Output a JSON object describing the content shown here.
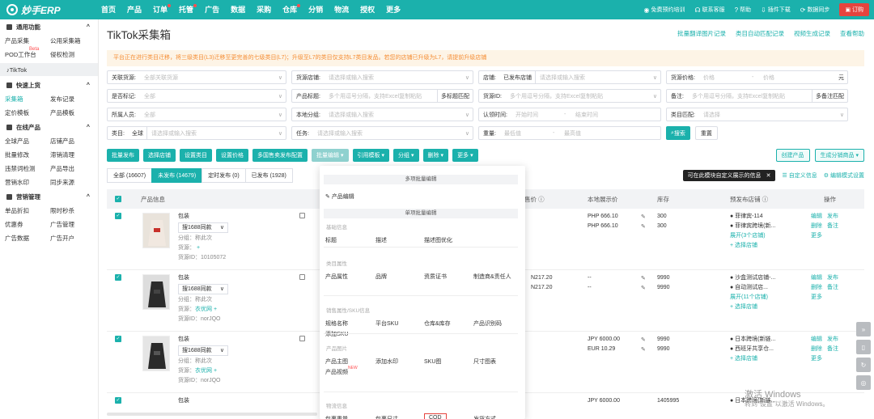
{
  "topnav": {
    "logo": "妙手ERP",
    "items": [
      {
        "label": "首页",
        "dot": false
      },
      {
        "label": "产品",
        "dot": false
      },
      {
        "label": "订单",
        "dot": true
      },
      {
        "label": "托管",
        "dot": true
      },
      {
        "label": "广告",
        "dot": false
      },
      {
        "label": "数据",
        "dot": false
      },
      {
        "label": "采购",
        "dot": false
      },
      {
        "label": "仓库",
        "dot": true
      },
      {
        "label": "分销",
        "dot": false
      },
      {
        "label": "物流",
        "dot": false
      },
      {
        "label": "授权",
        "dot": false
      },
      {
        "label": "更多",
        "dot": false
      }
    ],
    "right": [
      {
        "icon": "chat-icon",
        "label": "免费预约培训"
      },
      {
        "icon": "headset-icon",
        "label": "联系客服"
      },
      {
        "icon": "help-icon",
        "label": "帮助"
      },
      {
        "icon": "download-icon",
        "label": "插件下载"
      },
      {
        "icon": "sync-icon",
        "label": "数据同步"
      }
    ],
    "order_btn": "订购"
  },
  "sidebar": {
    "groups": [
      {
        "title": "通用功能",
        "rows": [
          [
            "产品采集",
            "公用采集箱"
          ],
          [
            "POD工作台",
            "侵权检测"
          ]
        ],
        "beta": "Beta"
      },
      {
        "title": "快速上货",
        "rows": [
          [
            "采集箱",
            "发布记录"
          ],
          [
            "定价模板",
            "产品模板"
          ]
        ]
      },
      {
        "title": "在线产品",
        "rows": [
          [
            "全球产品",
            "店铺产品"
          ],
          [
            "批量修改",
            "滞销清理"
          ],
          [
            "违禁词检测",
            "产品导出"
          ],
          [
            "营销水印",
            "同步来源"
          ]
        ]
      },
      {
        "title": "营销管理",
        "rows": [
          [
            "单品折扣",
            "限时秒杀"
          ],
          [
            "优惠券",
            "广告管理"
          ],
          [
            "广告数据",
            "广告开户"
          ]
        ]
      }
    ],
    "tiktok": "TikTok"
  },
  "page": {
    "title": "TikTok采集箱",
    "links": [
      "批量翻译图片记录",
      "类目自动匹配记录",
      "视频生成记录",
      "查看帮助"
    ],
    "notice": "平台正在进行类目迁移，将三级类目(L3)迁移至更完善的七级类目(L7)；升级至L7的类目仅支持L7类目发品。若您的店铺已升级为L7，请提前升级店铺"
  },
  "filters": {
    "row1": [
      {
        "label": "关联货源:",
        "placeholder": "全部关联货源",
        "w": 222
      },
      {
        "label": "货源店铺:",
        "placeholder": "请选择或输入搜索",
        "w": 225
      },
      {
        "label": "店铺:",
        "value": "已发布店铺",
        "placeholder": "请选择或输入搜索",
        "w": 226
      },
      {
        "label": "货源价格:",
        "placeholder": "价格",
        "placeholder2": "价格",
        "unit": "元",
        "w": 225
      }
    ],
    "row2": [
      {
        "label": "是否标记:",
        "placeholder": "全部",
        "w": 222
      },
      {
        "label": "产品标题:",
        "placeholder": "多个用逗号分隔，支持Excel复制粘贴",
        "seg": "多标题匹配",
        "w": 225
      },
      {
        "label": "货源ID:",
        "placeholder": "多个用逗号分隔，支持Excel复制粘贴",
        "w": 226
      },
      {
        "label": "备注:",
        "placeholder": "多个用逗号分隔，支持Excel复制粘贴",
        "seg": "多备注匹配",
        "w": 225
      }
    ],
    "row3": [
      {
        "label": "所属人员:",
        "placeholder": "全部",
        "w": 222
      },
      {
        "label": "本地分组:",
        "placeholder": "请选择或输入搜索",
        "w": 225
      },
      {
        "label": "认领时间:",
        "placeholder": "开始时间",
        "placeholder2": "结束时间",
        "w": 226
      },
      {
        "label": "类目匹配:",
        "placeholder": "请选择",
        "w": 225
      }
    ],
    "row4": [
      {
        "label": "类目:",
        "value": "全球",
        "placeholder": "请选择或输入搜索",
        "w": 222
      },
      {
        "label": "任务:",
        "placeholder": "请选择或输入搜索",
        "w": 225
      },
      {
        "label": "重量:",
        "placeholder": "最低值",
        "placeholder2": "最高值",
        "w": 226
      }
    ],
    "search_btn": "搜索",
    "reset_btn": "重置"
  },
  "toolbar": {
    "buttons": [
      {
        "label": "批量发布",
        "dim": false,
        "caret": false
      },
      {
        "label": "选择店铺",
        "dim": false,
        "caret": false
      },
      {
        "label": "设置类目",
        "dim": false,
        "caret": false
      },
      {
        "label": "设置价格",
        "dim": false,
        "caret": false
      },
      {
        "label": "多国售卖发布配置",
        "dim": false,
        "caret": false
      },
      {
        "label": "批量编辑",
        "dim": true,
        "caret": true
      },
      {
        "label": "引用模板",
        "dim": false,
        "caret": true
      },
      {
        "label": "分组",
        "dim": false,
        "caret": true
      },
      {
        "label": "删除",
        "dim": false,
        "caret": true
      },
      {
        "label": "更多",
        "dim": false,
        "caret": true
      }
    ],
    "create_product": "创建产品",
    "generate_goods": "生成分销商品"
  },
  "tabs": [
    {
      "label": "全部 (16607)",
      "active": false
    },
    {
      "label": "未发布 (14679)",
      "active": true
    },
    {
      "label": "定时发布 (0)",
      "active": false
    },
    {
      "label": "已发布 (1928)",
      "active": false
    }
  ],
  "tab_right": {
    "tooltip": "可在此模块自定义展示的信息",
    "custom_info": "自定义信息",
    "edit_mode": "编辑模式设置"
  },
  "grid": {
    "headers": [
      "产品信息",
      "售价",
      "本地展示价",
      "库存",
      "预发布店铺",
      "操作"
    ],
    "rows": [
      {
        "name": "包装",
        "src": "搜1688同款",
        "group": "分组：",
        "group_val": "称此次",
        "origin": "货源：",
        "origin_link": "",
        "id": "货源ID：10105072",
        "cur": [
          "",
          ""
        ],
        "local": [
          "PHP 666.10",
          "PHP 666.10"
        ],
        "stock": [
          "300",
          "300"
        ],
        "stores": [
          "● 菲律宾-114",
          "● 菲律宾跨境(新..."
        ],
        "more": "展开(3个店铺)",
        "select": "+ 选择店铺",
        "ops": [
          [
            "编辑",
            "发布"
          ],
          [
            "删除",
            "备注"
          ],
          [
            "更多",
            ""
          ]
        ]
      },
      {
        "name": "包装",
        "src": "搜1688同款",
        "group": "分组：",
        "group_val": "称此次",
        "origin": "货源：",
        "origin_link": "衣优网",
        "id": "货源ID：norJQO",
        "cur": [
          "N217.20",
          "N217.20"
        ],
        "local": [
          "--",
          "--"
        ],
        "stock": [
          "9990",
          "9990"
        ],
        "stores": [
          "● 沙盒测试店铺-...",
          "● 自动测试店..."
        ],
        "more": "展开(11个店铺)",
        "select": "+ 选择店铺",
        "ops": [
          [
            "编辑",
            "发布"
          ],
          [
            "删除",
            "备注"
          ],
          [
            "更多",
            ""
          ]
        ]
      },
      {
        "name": "包装",
        "src": "搜1688同款",
        "group": "分组：",
        "group_val": "称此次",
        "origin": "货源：",
        "origin_link": "衣优网",
        "id": "货源ID：norJQO",
        "cur": [
          "",
          ""
        ],
        "local": [
          "JPY 6000.00",
          "EUR 10.29"
        ],
        "stock": [
          "9990",
          "9990"
        ],
        "stores": [
          "● 日本跨境(新链...",
          "● 西班牙共享仓..."
        ],
        "more": "",
        "select": "+ 选择店铺",
        "ops": [
          [
            "编辑",
            "发布"
          ],
          [
            "删除",
            "备注"
          ],
          [
            "更多",
            ""
          ]
        ]
      }
    ],
    "row4": {
      "name": "包装",
      "local": "JPY 6000.00",
      "stock": "1405995",
      "store": "● 日本跨境(新链..."
    }
  },
  "dropdown": {
    "sec_multi": "多项批量编辑",
    "product_edit": "产品编辑",
    "sec_single": "单项批量编辑",
    "cats": [
      {
        "label": "基础信息",
        "items": [
          "标题",
          "描述",
          "描述图优化"
        ]
      },
      {
        "label": "类目属性",
        "items": [
          "产品属性",
          "品牌",
          "资质证书",
          "制造商&责任人"
        ]
      },
      {
        "label": "销售属性/SKU信息",
        "items": [
          "规格名称",
          "平台SKU",
          "仓库&库存",
          "产品识别码",
          "添加SKU"
        ]
      },
      {
        "label": "产品图片",
        "items": [
          "产品主图",
          "添加水印",
          "SKU图",
          "尺寸图表",
          "产品视频"
        ]
      },
      {
        "label": "物流信息",
        "items": [
          "包裹重量",
          "包裹尺寸",
          "COD",
          "发货方式"
        ]
      }
    ],
    "new_badge": "NEW"
  },
  "watermark": {
    "line1": "激活 Windows",
    "line2": "转到\"设置\"以激活 Windows。"
  },
  "colors": {
    "brand": "#1bb1ac",
    "danger": "#e6443e",
    "notice_bg": "#fdf4e6",
    "notice_text": "#f58e35"
  }
}
